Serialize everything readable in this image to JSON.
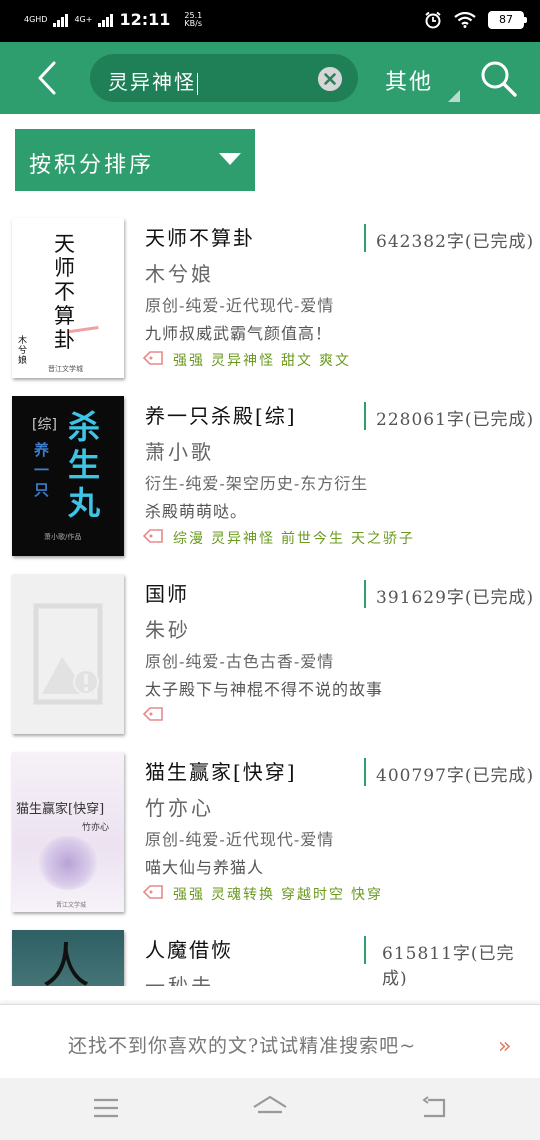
{
  "status_bar": {
    "net1": "4GHD",
    "net2": "4G+",
    "time": "12:11",
    "speed_value": "25.1",
    "speed_unit": "KB/s",
    "battery": "87"
  },
  "top_bar": {
    "search_value": "灵异神怪",
    "filter_label": "其他",
    "back_icon": "chevron-left-icon",
    "clear_icon": "close-circle-icon",
    "search_icon": "search-icon"
  },
  "sort": {
    "label": "按积分排序",
    "icon": "triangle-down-icon"
  },
  "books": [
    {
      "title": "天师不算卦",
      "words": "642382字(已完成)",
      "author": "木兮娘",
      "category": "原创-纯爱-近代现代-爱情",
      "intro": "九师叔威武霸气颜值高！",
      "tags": [
        "强强",
        "灵异神怪",
        "甜文",
        "爽文"
      ],
      "cover": {
        "big": "天师不算卦",
        "author": "木兮娘",
        "publisher": "晋江文学城"
      }
    },
    {
      "title": "养一只杀殿[综]",
      "words": "228061字(已完成)",
      "author": "萧小歌",
      "category": "衍生-纯爱-架空历史-东方衍生",
      "intro": "杀殿萌萌哒。",
      "tags": [
        "综漫",
        "灵异神怪",
        "前世今生",
        "天之骄子"
      ],
      "cover": {
        "big": "杀生丸",
        "tag": "[综]",
        "sub": "养一只",
        "author": "萧小歌/作品"
      }
    },
    {
      "title": "国师",
      "words": "391629字(已完成)",
      "author": "朱砂",
      "category": "原创-纯爱-古色古香-爱情",
      "intro": "太子殿下与神棍不得不说的故事",
      "tags": [],
      "cover": {
        "placeholder": "image-placeholder-icon"
      }
    },
    {
      "title": "猫生赢家[快穿]",
      "words": "400797字(已完成)",
      "author": "竹亦心",
      "category": "原创-纯爱-近代现代-爱情",
      "intro": "喵大仙与养猫人",
      "tags": [
        "强强",
        "灵魂转换",
        "穿越时空",
        "快穿"
      ],
      "cover": {
        "big": "猫生赢家[快穿]",
        "author": "竹亦心",
        "publisher": "晋江文学城"
      }
    },
    {
      "title": "人魔借恢",
      "words": "615811字(已完成)",
      "author": "一秒未",
      "category": "",
      "intro": "",
      "tags": [],
      "cover": {
        "big": "人"
      }
    }
  ],
  "bottom_tip": {
    "text": "还找不到你喜欢的文?试试精准搜索吧~",
    "arrow": "»"
  },
  "nav": {
    "menu_icon": "menu-icon",
    "home_icon": "home-icon",
    "back_icon": "back-icon"
  },
  "colors": {
    "primary": "#2f9e6f",
    "primary_dark": "#1f7f57",
    "tag_green": "#6a9a1f",
    "tag_icon": "#e88a8a"
  }
}
